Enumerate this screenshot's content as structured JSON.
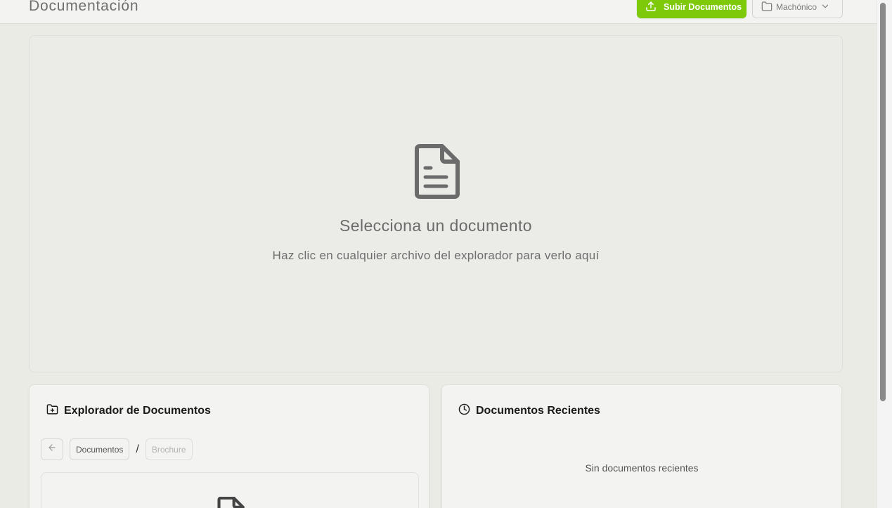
{
  "header": {
    "title": "Documentación",
    "upload_label": "Subir Documentos",
    "project_value": "Machónico"
  },
  "viewer": {
    "title": "Selecciona un documento",
    "hint": "Haz clic en cualquier archivo del explorador para verlo aquí"
  },
  "explorer": {
    "title": "Explorador de Documentos",
    "breadcrumbs": [
      "Documentos",
      "Brochure"
    ],
    "separator": "/"
  },
  "recent": {
    "title": "Documentos Recientes",
    "empty": "Sin documentos recientes"
  },
  "colors": {
    "accent": "#7dc90a",
    "background": "#ebebe6",
    "card": "#f3f3f1"
  },
  "icons": {
    "upload": "upload-icon",
    "folder": "folder-icon",
    "chevron": "chevron-down-icon",
    "document": "file-text-icon",
    "folder_plus": "folder-plus-icon",
    "clock": "clock-icon",
    "back": "arrow-left-icon"
  }
}
